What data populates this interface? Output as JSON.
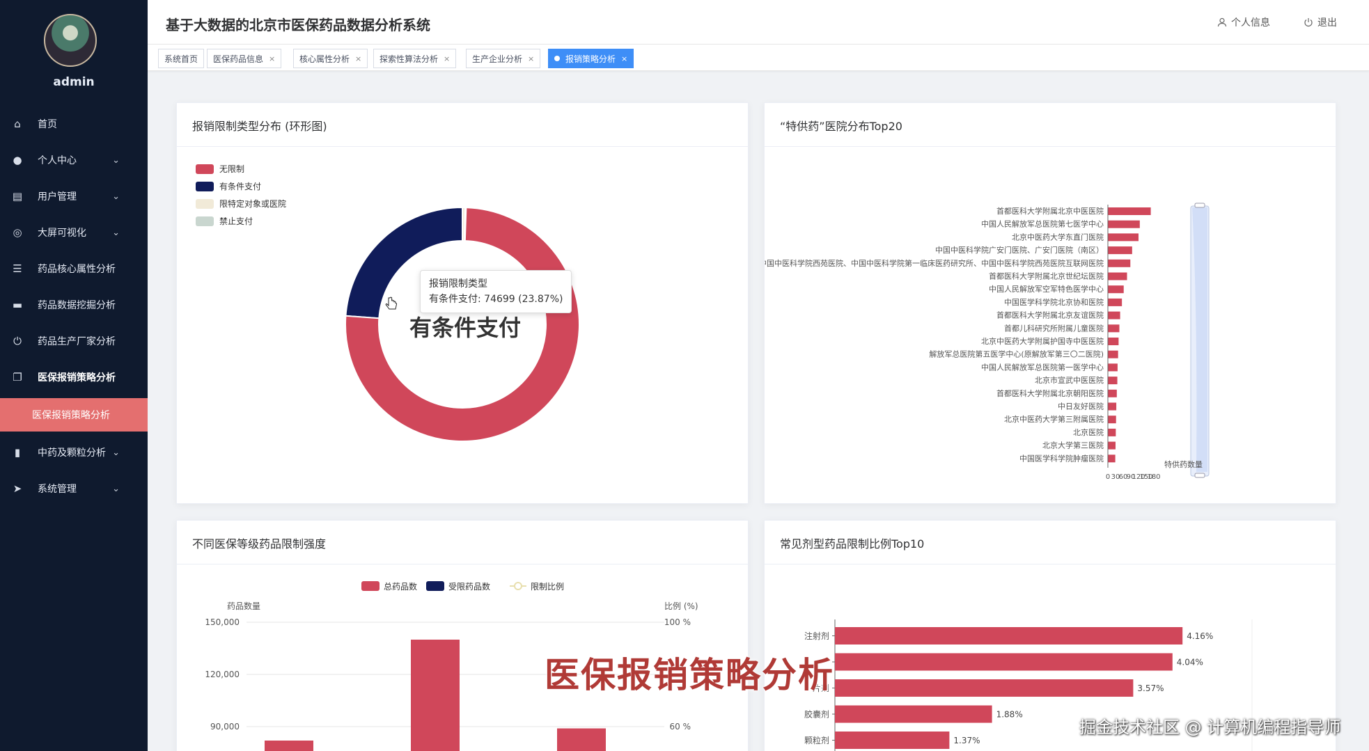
{
  "app": {
    "title": "基于大数据的北京市医保药品数据分析系统"
  },
  "header": {
    "profile_label": "个人信息",
    "logout_label": "退出"
  },
  "sidebar": {
    "username": "admin",
    "items": [
      {
        "label": "首页",
        "icon": "home-icon",
        "has_children": false
      },
      {
        "label": "个人中心",
        "icon": "user-icon",
        "has_children": true
      },
      {
        "label": "用户管理",
        "icon": "clipboard-icon",
        "has_children": true
      },
      {
        "label": "大屏可视化",
        "icon": "target-icon",
        "has_children": true
      },
      {
        "label": "药品核心属性分析",
        "icon": "list-icon",
        "has_children": false
      },
      {
        "label": "药品数据挖掘分析",
        "icon": "briefcase-icon",
        "has_children": false
      },
      {
        "label": "药品生产厂家分析",
        "icon": "power-icon",
        "has_children": false
      },
      {
        "label": "医保报销策略分析",
        "icon": "copy-icon",
        "has_children": false,
        "active": true
      },
      {
        "label": "中药及颗粒分析",
        "icon": "bar-icon",
        "has_children": true
      },
      {
        "label": "系统管理",
        "icon": "send-icon",
        "has_children": true
      }
    ],
    "active_sub": "医保报销策略分析"
  },
  "tabs": [
    {
      "label": "系统首页",
      "closable": false
    },
    {
      "label": "医保药品信息",
      "closable": true
    },
    {
      "label": "核心属性分析",
      "closable": true
    },
    {
      "label": "探索性算法分析",
      "closable": true
    },
    {
      "label": "生产企业分析",
      "closable": true
    },
    {
      "label": "报销策略分析",
      "closable": true,
      "active": true
    }
  ],
  "colors": {
    "red": "#d0475a",
    "navy": "#101c5a",
    "cream": "#f1ead8",
    "sage": "#c9d6cf",
    "sidebar": "#0f1a2e",
    "active_sub": "#e46f6f",
    "tab_active": "#3e8ef7"
  },
  "cards": {
    "donut": {
      "title": "报销限制类型分布 (环形图)"
    },
    "hospitals": {
      "title": "“特供药”医院分布Top20"
    },
    "levels": {
      "title": "不同医保等级药品限制强度"
    },
    "dosage": {
      "title": "常见剂型药品限制比例Top10"
    }
  },
  "tooltip": {
    "title": "报销限制类型",
    "line": "有条件支付: 74699 (23.87%)"
  },
  "donut_center": "有条件支付",
  "overlay_caption": "医保报销策略分析",
  "watermark": "掘金技术社区 @ 计算机编程指导师",
  "chart_data": [
    {
      "type": "pie",
      "title": "报销限制类型分布 (环形图)",
      "series": [
        {
          "name": "无限制",
          "value": 237000,
          "color": "#d0475a"
        },
        {
          "name": "有条件支付",
          "value": 74699,
          "percent": 23.87,
          "color": "#101c5a"
        },
        {
          "name": "限特定对象或医院",
          "value": 1200,
          "color": "#f1ead8"
        },
        {
          "name": "禁止支付",
          "value": 400,
          "color": "#c9d6cf"
        }
      ]
    },
    {
      "type": "bar",
      "orientation": "horizontal",
      "title": "“特供药”医院分布Top20",
      "legend": "特供药数量",
      "categories": [
        "首都医科大学附属北京中医医院",
        "中国人民解放军总医院第七医学中心",
        "北京中医药大学东直门医院",
        "中国中医科学院广安门医院、广安门医院（南区）",
        "中国中医科学院西苑医院、中国中医科学院第一临床医药研究所、中国中医科学院西苑医院互联网医院",
        "首都医科大学附属北京世纪坛医院",
        "中国人民解放军空军特色医学中心",
        "中国医学科学院北京协和医院",
        "首都医科大学附属北京友谊医院",
        "首都儿科研究所附属儿童医院",
        "北京中医药大学附属护国寺中医医院",
        "解放军总医院第五医学中心(原解放军第三〇二医院)",
        "中国人民解放军总医院第一医学中心",
        "北京市宣武中医医院",
        "首都医科大学附属北京朝阳医院",
        "中日友好医院",
        "北京中医药大学第三附属医院",
        "北京医院",
        "北京大学第三医院",
        "中国医学科学院肿瘤医院"
      ],
      "values": [
        168,
        125,
        120,
        95,
        88,
        75,
        62,
        55,
        48,
        45,
        42,
        40,
        38,
        37,
        35,
        33,
        32,
        31,
        30,
        29
      ],
      "xticks": [
        "0",
        "30",
        "60",
        "90",
        "120",
        "150",
        "180"
      ],
      "xlim": [
        0,
        180
      ]
    },
    {
      "type": "bar",
      "title": "不同医保等级药品限制强度",
      "legend": [
        "总药品数",
        "受限药品数",
        "限制比例"
      ],
      "ylabel": "药品数量",
      "y2label": "比例 (%)",
      "yticks": [
        "150,000",
        "120,000",
        "90,000"
      ],
      "y2ticks": [
        "100 %",
        "60 %"
      ],
      "ylim": [
        0,
        150000
      ],
      "series": [
        {
          "name": "总药品数",
          "values": [
            82000,
            140000,
            89000
          ]
        }
      ]
    },
    {
      "type": "bar",
      "orientation": "horizontal",
      "title": "常见剂型药品限制比例Top10",
      "categories": [
        "注射剂",
        "",
        "片剂",
        "胶囊剂",
        "颗粒剂"
      ],
      "values": [
        4.16,
        4.04,
        3.57,
        1.88,
        1.37
      ],
      "labels": [
        "4.16%",
        "4.04%",
        "3.57%",
        "1.88%",
        "1.37%"
      ],
      "xlim": [
        0,
        5
      ]
    }
  ]
}
